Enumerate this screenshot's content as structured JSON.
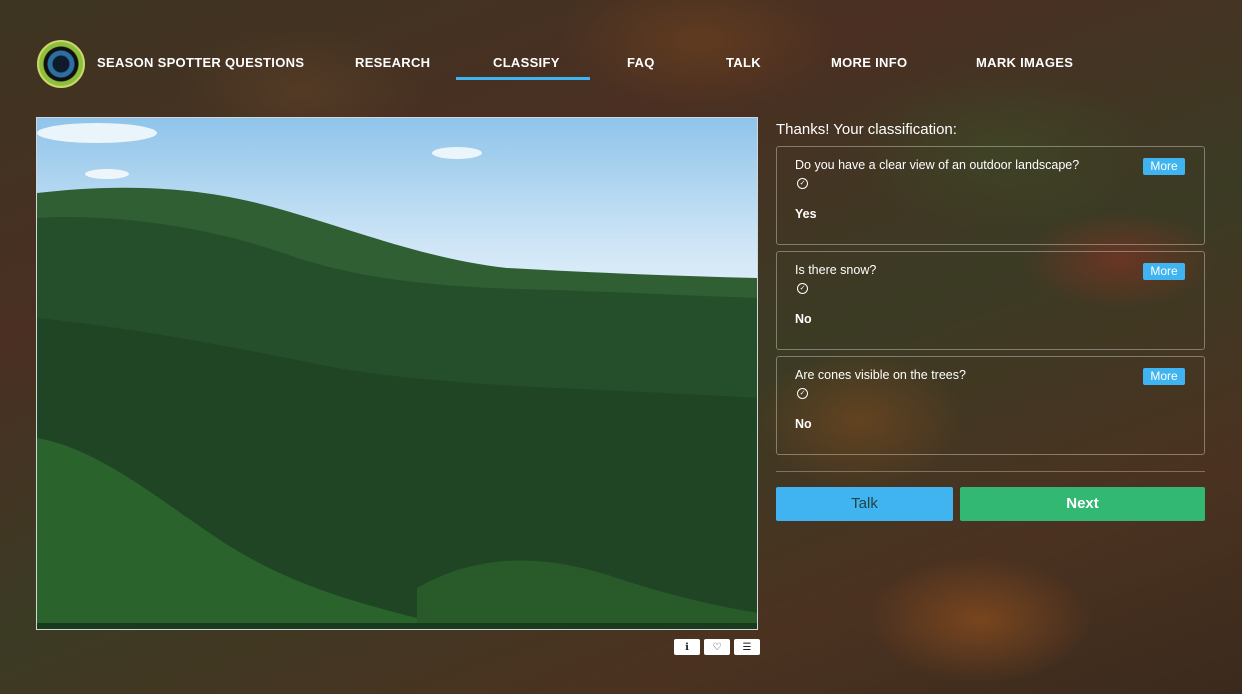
{
  "nav": {
    "brand": "SEASON SPOTTER QUESTIONS",
    "items": [
      "RESEARCH",
      "CLASSIFY",
      "FAQ",
      "TALK",
      "MORE INFO",
      "MARK IMAGES"
    ],
    "active": "CLASSIFY",
    "accent_color": "#3fb4f0"
  },
  "subject": {
    "image_icon": "forest-landscape-photo",
    "tools": [
      "info-icon",
      "heart-icon",
      "list-icon"
    ]
  },
  "summary": {
    "title": "Thanks! Your classification:",
    "more_label": "More",
    "questions": [
      {
        "question": "Do you have a clear view of an outdoor landscape?",
        "answer": "Yes"
      },
      {
        "question": "Is there snow?",
        "answer": "No"
      },
      {
        "question": "Are cones visible on the trees?",
        "answer": "No"
      }
    ]
  },
  "actions": {
    "talk_label": "Talk",
    "next_label": "Next",
    "talk_color": "#3fb4f0",
    "next_color": "#33b874"
  }
}
